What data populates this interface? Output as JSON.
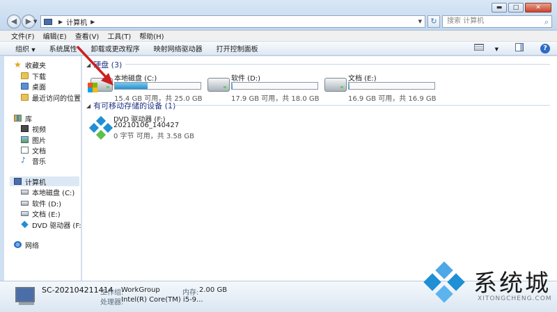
{
  "window": {
    "controls": {
      "minimize": "▬",
      "maximize": "□",
      "close": "✕"
    }
  },
  "address_bar": {
    "path": [
      "计算机"
    ],
    "search_placeholder": "搜索 计算机"
  },
  "menu": [
    "文件(F)",
    "编辑(E)",
    "查看(V)",
    "工具(T)",
    "帮助(H)"
  ],
  "command_bar": {
    "organize": "组织",
    "items": [
      "系统属性",
      "卸载或更改程序",
      "映射网络驱动器",
      "打开控制面板"
    ]
  },
  "nav_pane": {
    "favorites": {
      "label": "收藏夹",
      "items": [
        "下载",
        "桌面",
        "最近访问的位置"
      ]
    },
    "libraries": {
      "label": "库",
      "items": [
        "视频",
        "图片",
        "文档",
        "音乐"
      ]
    },
    "computer": {
      "label": "计算机",
      "items": [
        "本地磁盘 (C:)",
        "软件 (D:)",
        "文档 (E:)",
        "DVD 驱动器 (F:) 20"
      ]
    },
    "network": {
      "label": "网络"
    }
  },
  "content": {
    "hard_disks": {
      "header": "硬盘 (3)",
      "drives": [
        {
          "name": "本地磁盘 (C:)",
          "free": "15.4 GB 可用，共 25.0 GB",
          "used_fraction": 0.38
        },
        {
          "name": "软件 (D:)",
          "free": "17.9 GB 可用，共 18.0 GB",
          "used_fraction": 0.01
        },
        {
          "name": "文档 (E:)",
          "free": "16.9 GB 可用，共 16.9 GB",
          "used_fraction": 0.01
        }
      ]
    },
    "removable": {
      "header": "有可移动存储的设备 (1)",
      "device": {
        "name": "DVD 驱动器 (F:)",
        "label": "20210106_140427",
        "free": "0 字节 可用，共 3.58 GB"
      }
    }
  },
  "details": {
    "computer_name": "SC-202104211414",
    "workgroup_label": "工作组:",
    "workgroup": "WorkGroup",
    "memory_label": "内存:",
    "memory": "2.00 GB",
    "processor_label": "处理器:",
    "processor": "Intel(R) Core(TM) i5-9..."
  },
  "watermark": {
    "text": "系统城",
    "url": "XITONGCHENG.COM"
  },
  "colors": {
    "accent": "#2493d1",
    "annotation_arrow": "#cc1f1f",
    "group_header": "#1e3287"
  }
}
